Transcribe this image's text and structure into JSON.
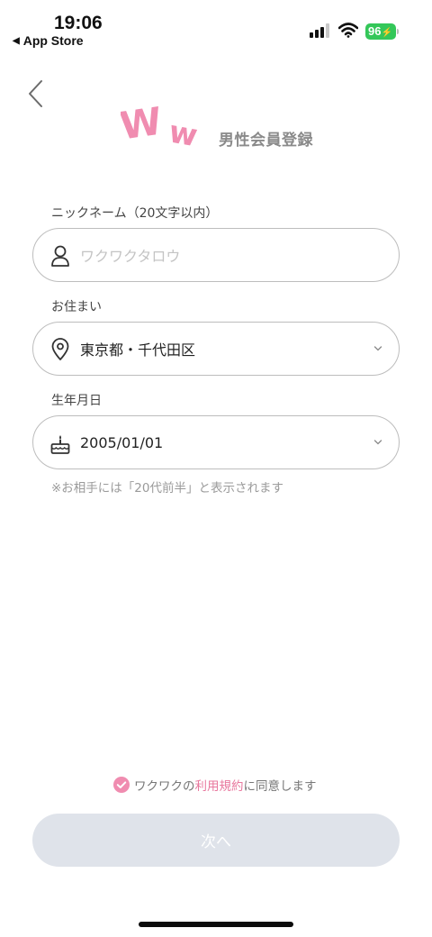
{
  "status_bar": {
    "time": "19:06",
    "back_app_label": "App Store",
    "battery_level": "96"
  },
  "header": {
    "logo_text": "WW",
    "title": "男性会員登録"
  },
  "form": {
    "nickname": {
      "label": "ニックネーム（20文字以内）",
      "placeholder": "ワクワクタロウ",
      "icon": "user-icon"
    },
    "residence": {
      "label": "お住まい",
      "value": "東京都・千代田区",
      "icon": "location-pin-icon"
    },
    "birthday": {
      "label": "生年月日",
      "value": "2005/01/01",
      "icon": "cake-icon",
      "note": "※お相手には「20代前半」と表示されます"
    }
  },
  "agreement": {
    "prefix": "ワクワクの",
    "link": "利用規約",
    "suffix": "に同意します",
    "checked": true
  },
  "next_button": {
    "label": "次へ"
  },
  "colors": {
    "brand_pink": "#f08cb0",
    "link_pink": "#e8789e",
    "button_disabled": "#dfe3ea",
    "battery_green": "#34c759"
  }
}
